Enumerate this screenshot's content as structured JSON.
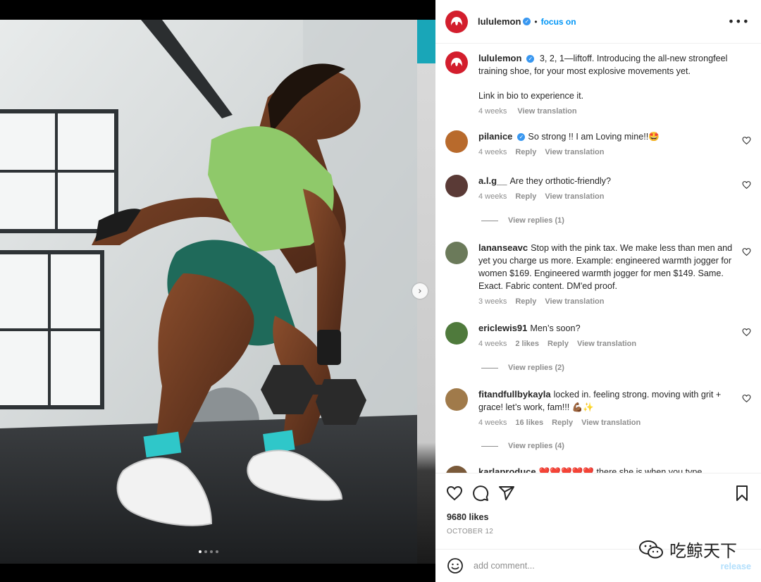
{
  "post": {
    "account": "lululemon",
    "separator": "•",
    "follow_label": "focus on",
    "more_label": "•••",
    "caption_user": "lululemon",
    "caption_text": "3, 2, 1—liftoff. Introducing the all-new strongfeel training shoe, for your most explosive movements yet.",
    "caption_text_2": "Link in bio to experience it.",
    "caption_time": "4 weeks",
    "caption_translate": "View translation",
    "likes": "9680 likes",
    "date": "OCTOBER 12",
    "photo_alt": "Athlete in a green sports bra and shorts squatting with a dumbbell while wearing white training shoes",
    "next_label": "›",
    "carousel_count": 4,
    "carousel_active_index": 0
  },
  "comments": [
    {
      "user": "pilanice",
      "verified": true,
      "text": "So strong !! I am Loving mine!!🤩",
      "time": "4 weeks",
      "likes": "",
      "reply": "Reply",
      "translate": "View translation",
      "avatar_color": "#b86a2c"
    },
    {
      "user": "a.l.g__",
      "verified": false,
      "text": "Are they orthotic-friendly?",
      "time": "4 weeks",
      "likes": "",
      "reply": "Reply",
      "translate": "View translation",
      "avatar_color": "#5a3a36",
      "view_replies": "View replies (1)"
    },
    {
      "user": "lananseavc",
      "verified": false,
      "text": "Stop with the pink tax. We make less than men and yet you charge us more. Example: engineered warmth jogger for women $169. Engineered warmth jogger for men $149. Same. Exact. Fabric content. DM'ed proof.",
      "time": "3 weeks",
      "likes": "",
      "reply": "Reply",
      "translate": "View translation",
      "avatar_color": "#6b7a5a"
    },
    {
      "user": "ericlewis91",
      "verified": false,
      "text": "Men’s soon?",
      "time": "4 weeks",
      "likes": "2 likes",
      "reply": "Reply",
      "translate": "View translation",
      "avatar_color": "#4f7a3c",
      "view_replies": "View replies (2)"
    },
    {
      "user": "fitandfullbykayla",
      "verified": false,
      "text": "locked in. feeling strong. moving with grit + grace! let’s work, fam!!! 💪🏾✨",
      "time": "4 weeks",
      "likes": "16 likes",
      "reply": "Reply",
      "translate": "View translation",
      "avatar_color": "#a07a4a",
      "view_replies": "View replies (4)"
    },
    {
      "user": "karlaproduce",
      "verified": false,
      "text": "❤️❤️❤️❤️❤️ there she is when you type",
      "time": "",
      "likes": "",
      "reply": "",
      "translate": "",
      "avatar_color": "#7a5a3a"
    }
  ],
  "composer": {
    "placeholder": "add comment...",
    "post_label": "release"
  },
  "watermark": {
    "text": "吃鲸天下"
  },
  "colors": {
    "brand_red": "#d31e2d",
    "link_blue": "#0095f6",
    "muted_text": "#8e8e8e",
    "post_disabled": "#b2dffc"
  },
  "icons": {
    "heart": "heart-icon",
    "comment": "comment-icon",
    "share": "paper-plane-icon",
    "save": "bookmark-icon",
    "emoji": "smiley-icon",
    "more": "ellipsis-icon",
    "verified": "verified-badge-icon"
  }
}
